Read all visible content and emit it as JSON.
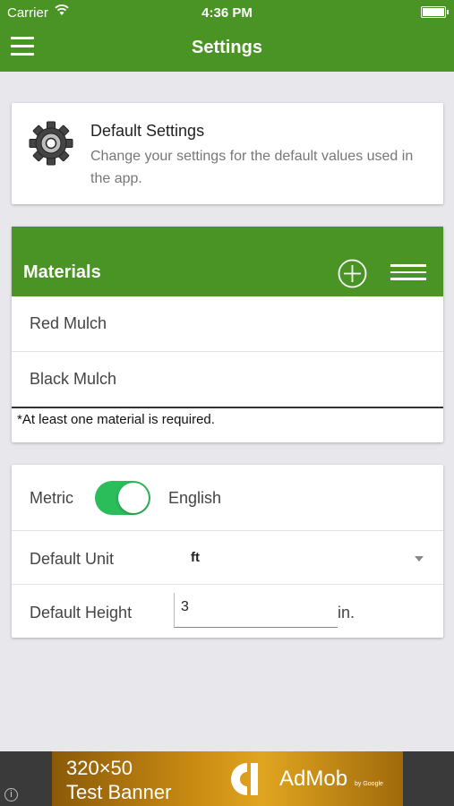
{
  "status_bar": {
    "carrier": "Carrier",
    "time": "4:36 PM"
  },
  "navbar": {
    "title": "Settings"
  },
  "default_settings": {
    "heading": "Default Settings",
    "description": "Change your settings for the default values used in the app."
  },
  "materials": {
    "title": "Materials",
    "items": [
      {
        "label": "Red Mulch"
      },
      {
        "label": "Black Mulch"
      }
    ],
    "note": "*At least one material is required."
  },
  "units": {
    "metric_label": "Metric",
    "english_label": "English",
    "toggle_on": true,
    "default_unit_label": "Default Unit",
    "default_unit_value": "ft",
    "default_height_label": "Default Height",
    "default_height_value": "3",
    "height_unit": "in."
  },
  "ad": {
    "line1": "320×50",
    "line2": "Test Banner",
    "brand": "AdMob",
    "by": "by Google",
    "info": "i"
  },
  "colors": {
    "primary": "#4a9426",
    "toggle": "#2bbd5a",
    "background": "#e8e8ec"
  }
}
